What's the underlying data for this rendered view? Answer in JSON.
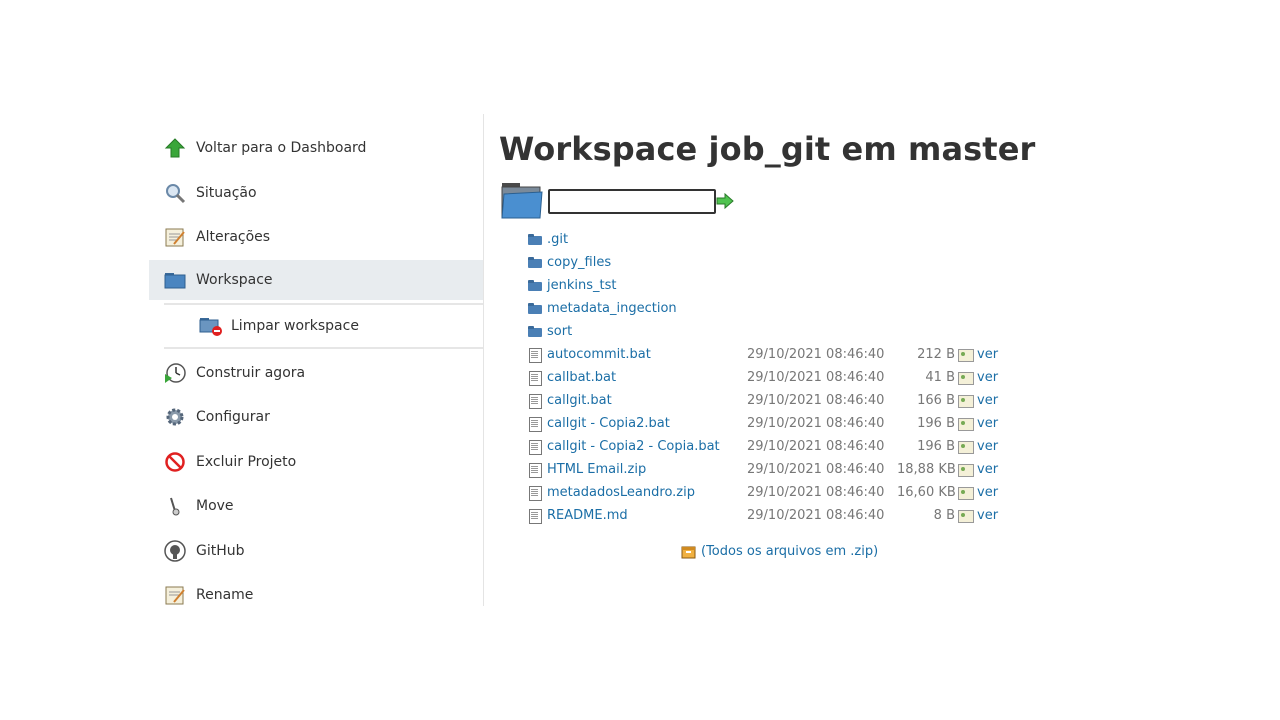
{
  "sidebar": {
    "items": [
      {
        "label": "Voltar para o Dashboard",
        "icon": "arrow-up-icon"
      },
      {
        "label": "Situação",
        "icon": "magnifier-icon"
      },
      {
        "label": "Alterações",
        "icon": "notepad-icon"
      },
      {
        "label": "Workspace",
        "icon": "folder-icon"
      },
      {
        "label": "Limpar workspace",
        "icon": "folder-delete-icon"
      },
      {
        "label": "Construir agora",
        "icon": "clock-play-icon"
      },
      {
        "label": "Configurar",
        "icon": "gear-icon"
      },
      {
        "label": "Excluir Projeto",
        "icon": "no-entry-icon"
      },
      {
        "label": "Move",
        "icon": "move-icon"
      },
      {
        "label": "GitHub",
        "icon": "github-icon"
      },
      {
        "label": "Rename",
        "icon": "notepad-icon"
      }
    ]
  },
  "main": {
    "title": "Workspace job_git em master",
    "path_input": {
      "value": ""
    },
    "files": [
      {
        "name": ".git",
        "type": "folder",
        "date": "",
        "size": ""
      },
      {
        "name": "copy_files",
        "type": "folder",
        "date": "",
        "size": ""
      },
      {
        "name": "jenkins_tst",
        "type": "folder",
        "date": "",
        "size": ""
      },
      {
        "name": "metadata_ingection",
        "type": "folder",
        "date": "",
        "size": ""
      },
      {
        "name": "sort",
        "type": "folder",
        "date": "",
        "size": ""
      },
      {
        "name": "autocommit.bat",
        "type": "file",
        "date": "29/10/2021 08:46:40",
        "size": "212 B",
        "view": "ver"
      },
      {
        "name": "callbat.bat",
        "type": "file",
        "date": "29/10/2021 08:46:40",
        "size": "41 B",
        "view": "ver"
      },
      {
        "name": "callgit.bat",
        "type": "file",
        "date": "29/10/2021 08:46:40",
        "size": "166 B",
        "view": "ver"
      },
      {
        "name": "callgit - Copia2.bat",
        "type": "file",
        "date": "29/10/2021 08:46:40",
        "size": "196 B",
        "view": "ver"
      },
      {
        "name": "callgit - Copia2 - Copia.bat",
        "type": "file",
        "date": "29/10/2021 08:46:40",
        "size": "196 B",
        "view": "ver"
      },
      {
        "name": "HTML Email.zip",
        "type": "file",
        "date": "29/10/2021 08:46:40",
        "size": "18,88 KB",
        "view": "ver"
      },
      {
        "name": "metadadosLeandro.zip",
        "type": "file",
        "date": "29/10/2021 08:46:40",
        "size": "16,60 KB",
        "view": "ver"
      },
      {
        "name": "README.md",
        "type": "file",
        "date": "29/10/2021 08:46:40",
        "size": "8 B",
        "view": "ver"
      }
    ],
    "zip_link": "(Todos os arquivos em .zip)"
  }
}
